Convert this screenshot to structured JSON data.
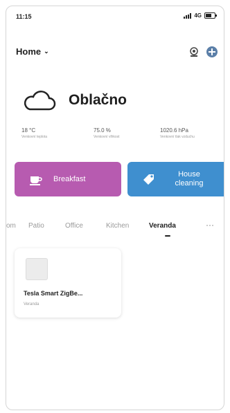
{
  "status_bar": {
    "time": "11:15",
    "network": "4G"
  },
  "header": {
    "home_label": "Home"
  },
  "weather": {
    "condition": "Oblačno",
    "stats": [
      {
        "value": "18 °C",
        "label": "Venkovní teplota"
      },
      {
        "value": "75.0 %",
        "label": "Venkovní vlhkost"
      },
      {
        "value": "1020.6 hPa",
        "label": "Venkovní tlak vzduchu"
      }
    ]
  },
  "scenes": [
    {
      "label": "Breakfast",
      "color": "#b75bb0",
      "icon": "coffee-cup-icon"
    },
    {
      "label": "House cleaning",
      "color": "#3f8fcf",
      "icon": "tag-icon"
    }
  ],
  "room_tabs": {
    "items": [
      "om",
      "Patio",
      "Office",
      "Kitchen",
      "Veranda"
    ],
    "active": "Veranda",
    "more_label": "···"
  },
  "devices": [
    {
      "name": "Tesla Smart ZigBe...",
      "room": "Veranda"
    }
  ]
}
